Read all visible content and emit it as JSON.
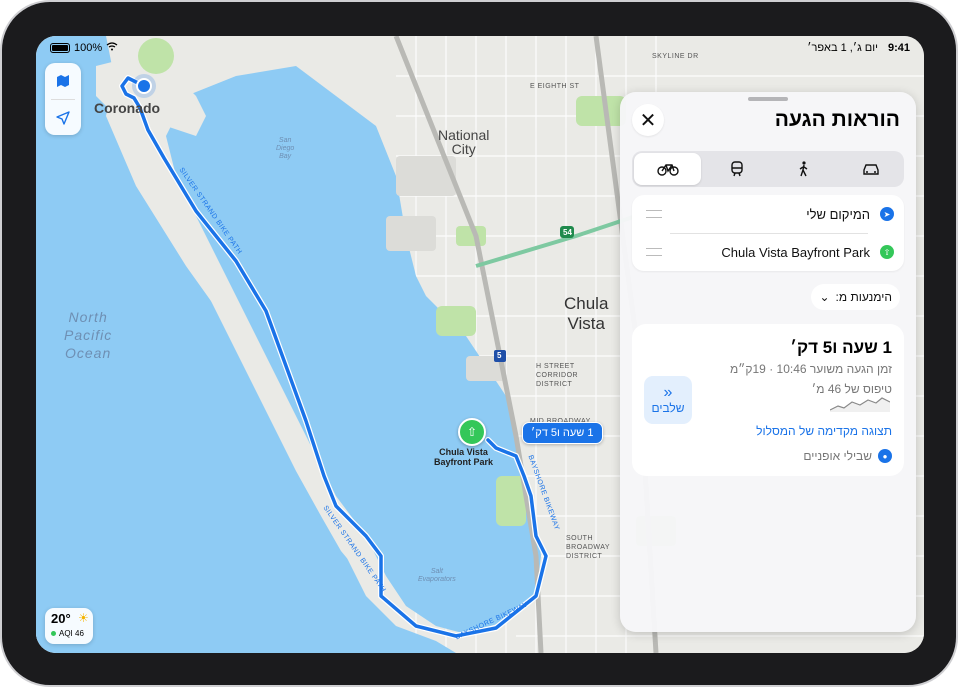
{
  "status_bar": {
    "time": "9:41",
    "date": "יום ג׳, 1 באפר׳",
    "battery_percent": "100%"
  },
  "map": {
    "labels": {
      "coronado": "Coronado",
      "ocean": "North\nPacific\nOcean",
      "bay": "San\nDiego\nBay",
      "national_city": "National\nCity",
      "chula_vista": "Chula\nVista",
      "skyline": "SKYLINE DR",
      "e_eighth": "E EIGHTH ST",
      "h_street": "H STREET\nCORRIDOR\nDISTRICT",
      "mid_broadway": "MID BROADWAY",
      "south_broadway": "SOUTH\nBROADWAY\nDISTRICT",
      "salt": "Salt\nEvaporators",
      "silver_strand": "SILVER STRAND BIKE PATH",
      "bayshore": "BAYSHORE BIKEWAY",
      "highway_54": "54",
      "highway_5": "5"
    },
    "destination_label": "Chula Vista\nBayfront Park",
    "route_bubble": "1 שעה ו5 דק׳"
  },
  "weather": {
    "temperature": "20°",
    "aqi": "AQI 46"
  },
  "panel": {
    "title": "הוראות הגעה",
    "modes": [
      "car-icon",
      "walk-icon",
      "transit-icon",
      "bike-icon"
    ],
    "selected_mode": "bike-icon",
    "from": "המיקום שלי",
    "to": "Chula Vista Bayfront Park",
    "avoid_label": "הימנעות מ:",
    "route": {
      "duration": "1 שעה ו5 דק׳",
      "eta": "זמן הגעה משוער 10:46 · 19ק״מ",
      "climb": "טיפוס של 46 מ׳",
      "steps_label": "שלבים",
      "preview_label": "תצוגה מקדימה של המסלול",
      "bike_lanes": "שבילי אופניים"
    }
  },
  "colors": {
    "route": "#1a73e8",
    "water": "#8ecbf4",
    "land": "#eaeae6",
    "park": "#bfe3a8",
    "destination": "#34c759"
  }
}
